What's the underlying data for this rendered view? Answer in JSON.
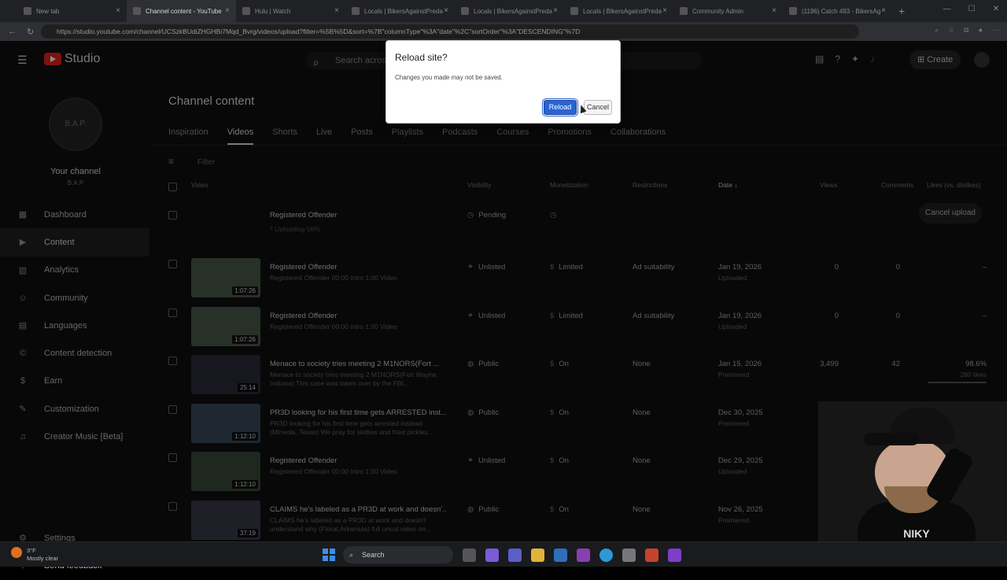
{
  "browser": {
    "tabs": [
      {
        "label": "New tab",
        "active": false
      },
      {
        "label": "Channel content - YouTube",
        "active": true
      },
      {
        "label": "Hulu | Watch",
        "active": false
      },
      {
        "label": "Locals | BikersAgainstPreda",
        "active": false
      },
      {
        "label": "Locals | BikersAgainstPreda",
        "active": false
      },
      {
        "label": "Locals | BikersAgainstPreda",
        "active": false
      },
      {
        "label": "Community Admin",
        "active": false
      },
      {
        "label": "(1196) Catch 493 - BikersAg",
        "active": false
      }
    ],
    "url": "https://studio.youtube.com/channel/UCSzkBUdiZHGHBi7Mqd_Bvrg/videos/upload?filter=%5B%5D&sort=%7B\"columnType\"%3A\"date\"%2C\"sortOrder\"%3A\"DESCENDING\"%7D",
    "new_tab_symbol": "+",
    "close_symbol": "×"
  },
  "studio": {
    "logo_text": "Studio",
    "search_placeholder": "Search across your channel",
    "create_label": "Create",
    "channel": {
      "avatar_text": "B.A.P.",
      "your_channel": "Your channel",
      "handle": "B.A.P"
    },
    "nav": [
      {
        "label": "Dashboard",
        "icon": "▦",
        "active": false
      },
      {
        "label": "Content",
        "icon": "▶",
        "active": true
      },
      {
        "label": "Analytics",
        "icon": "▥",
        "active": false
      },
      {
        "label": "Community",
        "icon": "☺",
        "active": false
      },
      {
        "label": "Languages",
        "icon": "▤",
        "active": false
      },
      {
        "label": "Content detection",
        "icon": "©",
        "active": false
      },
      {
        "label": "Earn",
        "icon": "$",
        "active": false
      },
      {
        "label": "Customization",
        "icon": "✎",
        "active": false
      },
      {
        "label": "Creator Music [Beta]",
        "icon": "♫",
        "active": false
      }
    ],
    "bottom_nav": [
      {
        "label": "Settings",
        "icon": "⚙"
      },
      {
        "label": "Send feedback",
        "icon": "!"
      }
    ],
    "page_title": "Channel content",
    "content_tabs": [
      {
        "label": "Inspiration",
        "active": false
      },
      {
        "label": "Videos",
        "active": true
      },
      {
        "label": "Shorts",
        "active": false
      },
      {
        "label": "Live",
        "active": false
      },
      {
        "label": "Posts",
        "active": false
      },
      {
        "label": "Playlists",
        "active": false
      },
      {
        "label": "Podcasts",
        "active": false
      },
      {
        "label": "Courses",
        "active": false
      },
      {
        "label": "Promotions",
        "active": false
      },
      {
        "label": "Collaborations",
        "active": false
      }
    ],
    "filter_placeholder": "Filter",
    "columns": {
      "video": "Video",
      "visibility": "Visibility",
      "monetization": "Monetization",
      "restrictions": "Restrictions",
      "date": "Date ↓",
      "views": "Views",
      "comments": "Comments",
      "likes": "Likes (vs. dislikes)"
    },
    "uploading_row": {
      "title": "Registered Offender",
      "status": "Uploading 56%",
      "progress": 0.56,
      "visibility": "Pending",
      "cancel_label": "Cancel upload"
    },
    "videos": [
      {
        "title": "Registered Offender",
        "desc": "Registered Offender 00:00 intro 1:00 Video",
        "duration": "1:07:26",
        "visibility": "Unlisted",
        "monetization": "Limited",
        "restrictions": "Ad suitability",
        "date": "Jan 19, 2026",
        "date_sub": "Uploaded",
        "views": "0",
        "comments": "0",
        "likes": "–",
        "likes_sub": ""
      },
      {
        "title": "Registered Offender",
        "desc": "Registered Offender 00:00 intro 1:00 Video",
        "duration": "1:07:26",
        "visibility": "Unlisted",
        "monetization": "Limited",
        "restrictions": "Ad suitability",
        "date": "Jan 19, 2026",
        "date_sub": "Uploaded",
        "views": "0",
        "comments": "0",
        "likes": "–",
        "likes_sub": ""
      },
      {
        "title": "Menace to society tries meeting 2 M1NORS(Fort ...",
        "desc": "Menace to society tries meeting 2 M1NORS(Fort Wayne, Indiana) This case was taken over by the FBI...",
        "duration": "25:14",
        "visibility": "Public",
        "monetization": "On",
        "restrictions": "None",
        "date": "Jan 15, 2026",
        "date_sub": "Premiered",
        "views": "3,499",
        "comments": "42",
        "likes": "98.6%",
        "likes_sub": "280 likes"
      },
      {
        "title": "PR3D looking for his first time gets ARRESTED inst...",
        "desc": "PR3D looking for his first time gets arrested instead (Mineola, Texas) We pray for skittles and fried pickles...",
        "duration": "1:12:10",
        "visibility": "Public",
        "monetization": "On",
        "restrictions": "None",
        "date": "Dec 30, 2025",
        "date_sub": "Premiered",
        "views": "6,876",
        "comments": "",
        "likes": "97.7%",
        "likes_sub": "432 likes"
      },
      {
        "title": "Registered Offender",
        "desc": "Registered Offender 00:00 intro 1:00 Video",
        "duration": "1:12:10",
        "visibility": "Unlisted",
        "monetization": "On",
        "restrictions": "None",
        "date": "Dec 29, 2025",
        "date_sub": "Uploaded",
        "views": "0",
        "comments": "",
        "likes": "–",
        "likes_sub": ""
      },
      {
        "title": "CLAIMS he's labeled as a PR3D at work and doesn'...",
        "desc": "CLAIMS he's labeled as a PR3D at work and doesn't understand why (Floral,Arkansas) full uncut video on...",
        "duration": "37:19",
        "visibility": "Public",
        "monetization": "On",
        "restrictions": "None",
        "date": "Nov 26, 2025",
        "date_sub": "Premiered",
        "views": "",
        "comments": "",
        "likes": "",
        "likes_sub": ""
      }
    ]
  },
  "dialog": {
    "title": "Reload site?",
    "message": "Changes you made may not be saved.",
    "reload_label": "Reload",
    "cancel_label": "Cancel"
  },
  "webcam": {
    "shirt_text": "NIKY"
  },
  "taskbar": {
    "weather_temp": "3°F",
    "weather_desc": "Mostly clear",
    "search_label": "Search"
  },
  "colors": {
    "accent_red": "#e62117",
    "dialog_button": "#2864d7",
    "monetization_green": "#3f8f3f"
  }
}
